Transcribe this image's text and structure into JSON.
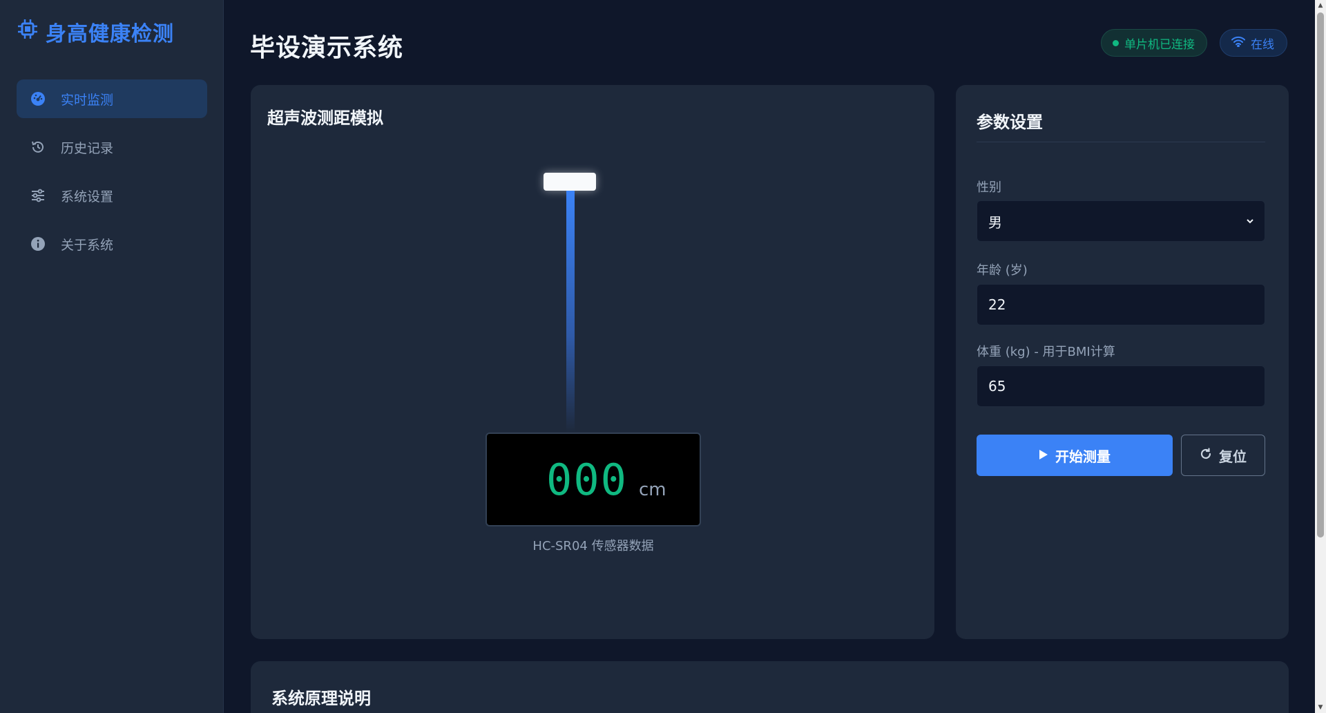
{
  "sidebar": {
    "brand": "身高健康检测",
    "items": [
      {
        "label": "实时监测",
        "icon": "gauge-icon",
        "active": true
      },
      {
        "label": "历史记录",
        "icon": "history-icon",
        "active": false
      },
      {
        "label": "系统设置",
        "icon": "sliders-icon",
        "active": false
      },
      {
        "label": "关于系统",
        "icon": "info-icon",
        "active": false
      }
    ]
  },
  "header": {
    "title": "毕设演示系统",
    "mcu_status": "单片机已连接",
    "online_status": "在线"
  },
  "simulation": {
    "title": "超声波测距模拟",
    "reading": "000",
    "unit": "cm",
    "caption": "HC-SR04 传感器数据"
  },
  "params": {
    "title": "参数设置",
    "gender_label": "性别",
    "gender_value": "男",
    "age_label": "年龄 (岁)",
    "age_value": "22",
    "weight_label": "体重 (kg) - 用于BMI计算",
    "weight_value": "65",
    "start_label": "开始测量",
    "reset_label": "复位"
  },
  "principle": {
    "title": "系统原理说明"
  },
  "colors": {
    "accent": "#3b82f6",
    "success": "#10b981",
    "background": "#0f172a",
    "card": "#1e293b"
  }
}
